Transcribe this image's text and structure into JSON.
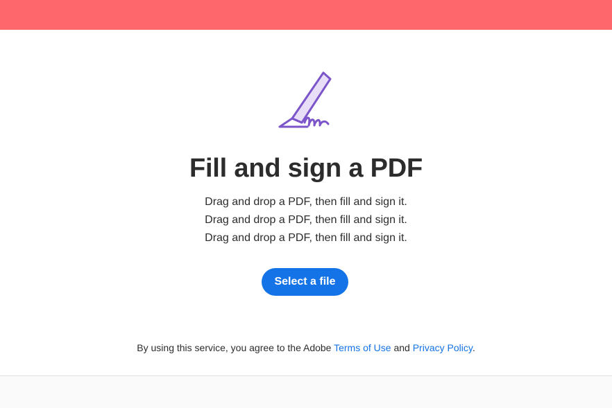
{
  "colors": {
    "banner": "#fe676c",
    "accent": "#1473e6",
    "icon_stroke": "#7b55c9",
    "icon_fill": "#e8def8"
  },
  "hero": {
    "icon": "fill-and-sign-pen-icon",
    "title": "Fill and sign a PDF",
    "description_lines": [
      "Drag and drop a PDF, then fill and sign it.",
      "Drag and drop a PDF, then fill and sign it.",
      "Drag and drop a PDF, then fill and sign it."
    ],
    "select_button_label": "Select a file"
  },
  "legal": {
    "prefix": "By using this service, you agree to the Adobe ",
    "terms_label": "Terms of Use",
    "conjunction": " and ",
    "privacy_label": "Privacy Policy",
    "suffix": "."
  }
}
